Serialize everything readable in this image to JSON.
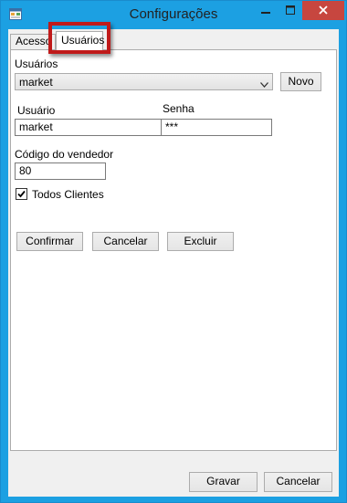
{
  "window": {
    "title": "Configurações",
    "icons": {
      "app": "form-window-icon",
      "minimize": "minimize-icon",
      "maximize": "maximize-icon",
      "close": "close-icon"
    }
  },
  "tabs": [
    {
      "label": "Acesso",
      "active": false
    },
    {
      "label": "Usuários",
      "active": true
    }
  ],
  "usuarios_tab": {
    "usuarios_label": "Usuários",
    "usuarios_selected": "market",
    "novo_button": "Novo",
    "usuario_label": "Usuário",
    "usuario_value": "market",
    "senha_label": "Senha",
    "senha_value": "***",
    "codigo_label": "Código do vendedor",
    "codigo_value": "80",
    "todos_clientes_label": "Todos Clientes",
    "todos_clientes_checked": true,
    "confirmar_button": "Confirmar",
    "cancelar_button": "Cancelar",
    "excluir_button": "Excluir"
  },
  "footer": {
    "gravar_button": "Gravar",
    "cancelar_button": "Cancelar"
  },
  "colors": {
    "window_border": "#1ca0e2",
    "close_button": "#c7463f",
    "highlight": "#c01a1a"
  }
}
